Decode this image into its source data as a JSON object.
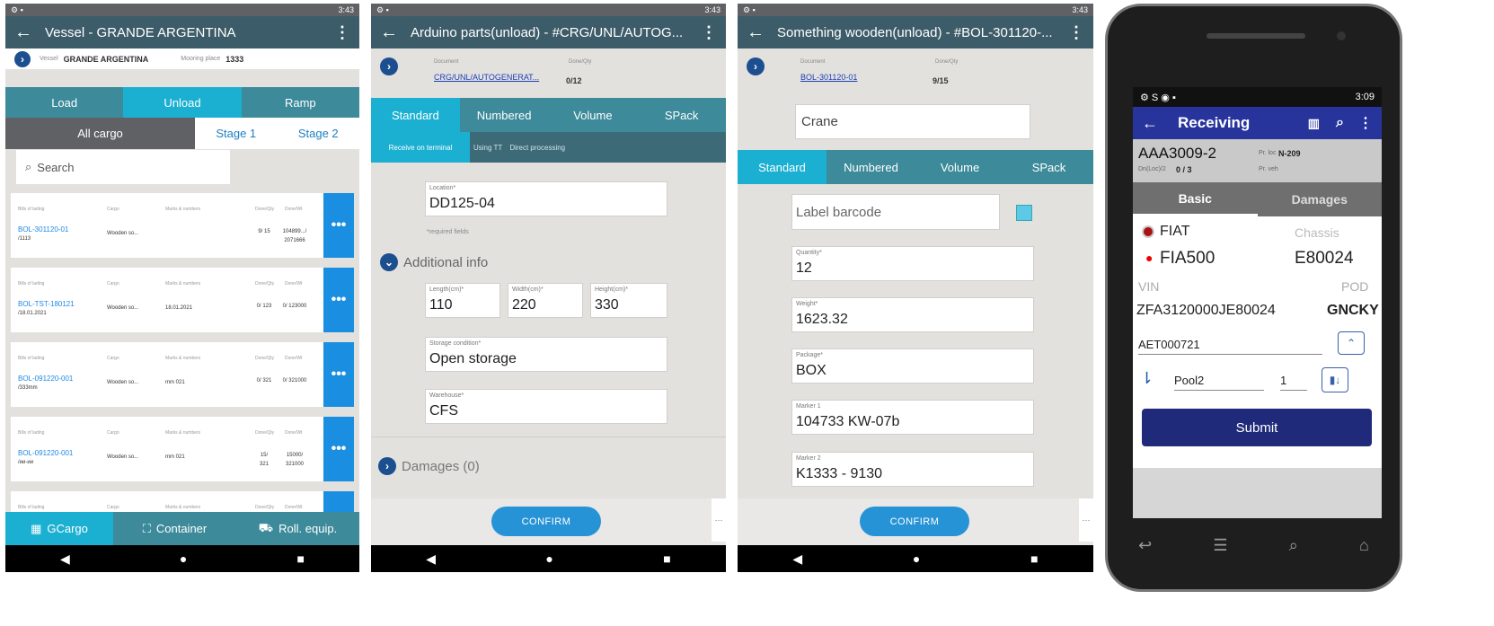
{
  "screen1": {
    "status_time": "3:43",
    "title": "Vessel - GRANDE ARGENTINA",
    "info_vessel_label": "Vessel",
    "info_vessel": "GRANDE ARGENTINA",
    "info_mooring_label": "Mooring place",
    "info_mooring": "1333",
    "tabs": [
      "Load",
      "Unload",
      "Ramp"
    ],
    "subtabs": [
      "All cargo",
      "Stage 1",
      "Stage 2"
    ],
    "search_placeholder": "Search",
    "col_labels": [
      "Bills of lading",
      "Cargo",
      "Marks & numbers",
      "Done/Qty",
      "Done/Wt"
    ],
    "cards": [
      {
        "bol": "BOL-301120-01",
        "sub": "/1113",
        "cargo": "Wooden so...",
        "marks": "",
        "q": "9/ 15",
        "w": "104899.../ 2071666"
      },
      {
        "bol": "BOL-TST-180121",
        "sub": "/18.01.2021",
        "cargo": "Wooden so...",
        "marks": "18.01.2021",
        "q": "0/ 123",
        "w": "0/ 123000"
      },
      {
        "bol": "BOL-091220-001",
        "sub": "/333mm",
        "cargo": "Wooden so...",
        "marks": "mm 021",
        "q": "0/ 321",
        "w": "0/ 321000"
      },
      {
        "bol": "BOL-091220-001",
        "sub": "/ии-ии",
        "cargo": "Wooden so...",
        "marks": "mm 021",
        "q": "15/ 321",
        "w": "15000/ 321000"
      }
    ],
    "bottom_tabs": [
      "GCargo",
      "Container",
      "Roll. equip."
    ]
  },
  "screen2": {
    "status_time": "3:43",
    "title": "Arduino parts(unload) - #CRG/UNL/AUTOG...",
    "doc_label": "Document",
    "doc_value": "CRG/UNL/AUTOGENERAT...",
    "qty_label": "Done/Qty",
    "qty_value": "0/12",
    "tabs": [
      "Standard",
      "Numbered",
      "Volume",
      "SPack"
    ],
    "subtabs": [
      "Receive on terminal",
      "Using TT",
      "Direct processing"
    ],
    "location_label": "Location*",
    "location_value": "DD125-04",
    "required_note": "*required fields",
    "additional_info": "Additional info",
    "length_label": "Length(cm)*",
    "length_value": "110",
    "width_label": "Width(cm)*",
    "width_value": "220",
    "height_label": "Height(cm)*",
    "height_value": "330",
    "storage_label": "Storage condition*",
    "storage_value": "Open storage",
    "warehouse_label": "Warehouse*",
    "warehouse_value": "CFS",
    "damages": "Damages (0)",
    "confirm": "CONFIRM"
  },
  "screen3": {
    "status_time": "3:43",
    "title": "Something wooden(unload) - #BOL-301120-...",
    "doc_label": "Document",
    "doc_value": "BOL-301120-01",
    "qty_label": "Done/Qty",
    "qty_value": "9/15",
    "crane": "Crane",
    "tabs": [
      "Standard",
      "Numbered",
      "Volume",
      "SPack"
    ],
    "label_barcode": "Label barcode",
    "quantity_label": "Quantity*",
    "quantity_value": "12",
    "weight_label": "Weight*",
    "weight_value": "1623.32",
    "package_label": "Package*",
    "package_value": "BOX",
    "marker1_label": "Marker 1",
    "marker1_value": "104733 KW-07b",
    "marker2_label": "Marker 2",
    "marker2_value": "K1333 - 9130",
    "confirm": "CONFIRM"
  },
  "phone": {
    "status_time": "3:09",
    "title": "Receiving",
    "id": "AAA3009-2",
    "prloc_label": "Pr. loc",
    "prloc_value": "N-209",
    "dnloc_label": "Dn(Loc)/2",
    "dnloc_value": "0 / 3",
    "prveh_label": "Pr. veh",
    "tabs": [
      "Basic",
      "Damages"
    ],
    "brand": "FIAT",
    "chassis_label": "Chassis",
    "model": "FIA500",
    "chassis_value": "E80024",
    "vin_label": "VIN",
    "pod_label": "POD",
    "vin_value": "ZFA3120000JE80024",
    "pod_value": "GNCKY",
    "aet": "AET000721",
    "pool": "Pool2",
    "pool_num": "1",
    "submit": "Submit",
    "colors": {
      "bar": "#27349c",
      "submit": "#1f2a7a"
    }
  }
}
